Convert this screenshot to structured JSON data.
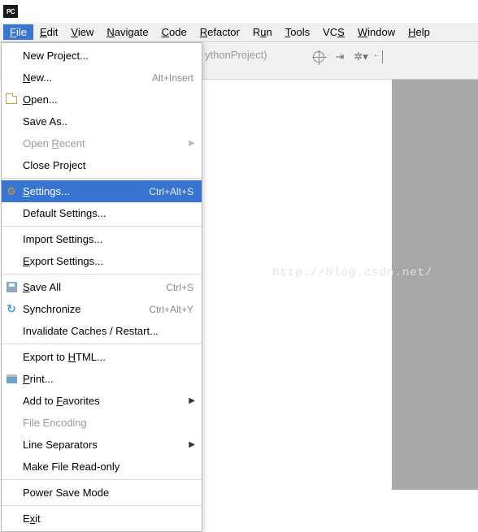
{
  "titlebar": {
    "badge": "PC"
  },
  "menubar": [
    {
      "label": "File",
      "mnemonic": 0,
      "active": true
    },
    {
      "label": "Edit",
      "mnemonic": 0
    },
    {
      "label": "View",
      "mnemonic": 0
    },
    {
      "label": "Navigate",
      "mnemonic": 0
    },
    {
      "label": "Code",
      "mnemonic": 0
    },
    {
      "label": "Refactor",
      "mnemonic": 0
    },
    {
      "label": "Run",
      "mnemonic": 1
    },
    {
      "label": "Tools",
      "mnemonic": 0
    },
    {
      "label": "VCS",
      "mnemonic": 2
    },
    {
      "label": "Window",
      "mnemonic": 0
    },
    {
      "label": "Help",
      "mnemonic": 0
    }
  ],
  "dropdown": [
    {
      "type": "item",
      "label": "New Project..."
    },
    {
      "type": "item",
      "label": "New...",
      "mnemonic": 0,
      "shortcut": "Alt+Insert"
    },
    {
      "type": "item",
      "label": "Open...",
      "mnemonic": 0,
      "icon": "folder"
    },
    {
      "type": "item",
      "label": "Save As.."
    },
    {
      "type": "item",
      "label": "Open Recent",
      "mnemonic": 5,
      "disabled": true,
      "submenu": true
    },
    {
      "type": "item",
      "label": "Close Project"
    },
    {
      "type": "sep"
    },
    {
      "type": "item",
      "label": "Settings...",
      "mnemonic": 0,
      "shortcut": "Ctrl+Alt+S",
      "icon": "gear",
      "highlight": true
    },
    {
      "type": "item",
      "label": "Default Settings..."
    },
    {
      "type": "sep"
    },
    {
      "type": "item",
      "label": "Import Settings..."
    },
    {
      "type": "item",
      "label": "Export Settings...",
      "mnemonic": 0
    },
    {
      "type": "sep"
    },
    {
      "type": "item",
      "label": "Save All",
      "mnemonic": 0,
      "shortcut": "Ctrl+S",
      "icon": "save"
    },
    {
      "type": "item",
      "label": "Synchronize",
      "shortcut": "Ctrl+Alt+Y",
      "icon": "sync"
    },
    {
      "type": "item",
      "label": "Invalidate Caches / Restart..."
    },
    {
      "type": "sep"
    },
    {
      "type": "item",
      "label": "Export to HTML...",
      "mnemonic": 10
    },
    {
      "type": "item",
      "label": "Print...",
      "mnemonic": 0,
      "icon": "print"
    },
    {
      "type": "item",
      "label": "Add to Favorites",
      "mnemonic": 7,
      "submenu": true
    },
    {
      "type": "item",
      "label": "File Encoding",
      "disabled": true
    },
    {
      "type": "item",
      "label": "Line Separators",
      "submenu": true
    },
    {
      "type": "item",
      "label": "Make File Read-only"
    },
    {
      "type": "sep"
    },
    {
      "type": "item",
      "label": "Power Save Mode"
    },
    {
      "type": "sep"
    },
    {
      "type": "item",
      "label": "Exit",
      "mnemonic": 1
    }
  ],
  "breadcrumb": {
    "text": "ythonProject)"
  },
  "watermark": "http://blog.csdn.net/"
}
